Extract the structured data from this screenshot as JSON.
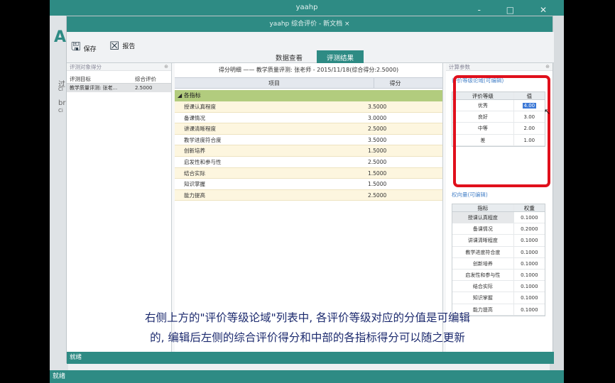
{
  "app": {
    "outer_title": "yaahp",
    "inner_title": "yaahp 综合评价 - 新文档 ×",
    "outer_status": "就绪",
    "inner_status": "就绪",
    "outer_left_labels": [
      "过",
      "Ci",
      "br",
      "Ci"
    ],
    "win_controls": "- □ ✕"
  },
  "toolbar": {
    "save_label": "保存",
    "report_label": "报告",
    "tabs": [
      {
        "label": "数据查看"
      },
      {
        "label": "评测结果"
      }
    ]
  },
  "left_panel": {
    "header": "评测对象得分",
    "col_target": "评测目标",
    "col_score": "综合评价",
    "rows": [
      {
        "target": "教学质量评测: 张老...",
        "score": "2.5000"
      }
    ]
  },
  "center_panel": {
    "title": "得分明细 —— 教学质量评测: 张老师 - 2015/11/18(综合得分:2.5000)",
    "col_item": "项目",
    "col_score": "得分",
    "group": "各指标",
    "rows": [
      {
        "item": "授课认真程度",
        "score": "3.5000"
      },
      {
        "item": "备课情况",
        "score": "3.0000"
      },
      {
        "item": "讲课清晰程度",
        "score": "2.5000"
      },
      {
        "item": "教学进度符合度",
        "score": "3.5000"
      },
      {
        "item": "创新培养",
        "score": "1.5000"
      },
      {
        "item": "启发性和参与性",
        "score": "2.5000"
      },
      {
        "item": "结合实际",
        "score": "1.5000"
      },
      {
        "item": "知识掌握",
        "score": "1.5000"
      },
      {
        "item": "能力提高",
        "score": "2.5000"
      }
    ]
  },
  "right_panel": {
    "header": "计算参数",
    "grade_title": "评价等级论域(可编辑)",
    "grade_col_level": "评价等级",
    "grade_col_value": "值",
    "grades": [
      {
        "level": "优秀",
        "value": "4.00"
      },
      {
        "level": "良好",
        "value": "3.00"
      },
      {
        "level": "中等",
        "value": "2.00"
      },
      {
        "level": "差",
        "value": "1.00"
      }
    ],
    "weight_title": "权向量(可编辑)",
    "weight_col_index": "指标",
    "weight_col_weight": "权重",
    "weights": [
      {
        "index": "授课认真程度",
        "weight": "0.1000"
      },
      {
        "index": "备课情况",
        "weight": "0.2000"
      },
      {
        "index": "讲课清晰程度",
        "weight": "0.1000"
      },
      {
        "index": "教学进度符合度",
        "weight": "0.1000"
      },
      {
        "index": "创新培养",
        "weight": "0.1000"
      },
      {
        "index": "启发性和参与性",
        "weight": "0.1000"
      },
      {
        "index": "结合实际",
        "weight": "0.1000"
      },
      {
        "index": "知识掌握",
        "weight": "0.1000"
      },
      {
        "index": "能力提高",
        "weight": "0.1000"
      }
    ]
  },
  "subtitle": {
    "line1": "右侧上方的\"评价等级论域\"列表中, 各评价等级对应的分值是可编辑",
    "line2": "的, 编辑后左侧的综合评价得分和中部的各指标得分可以随之更新"
  }
}
